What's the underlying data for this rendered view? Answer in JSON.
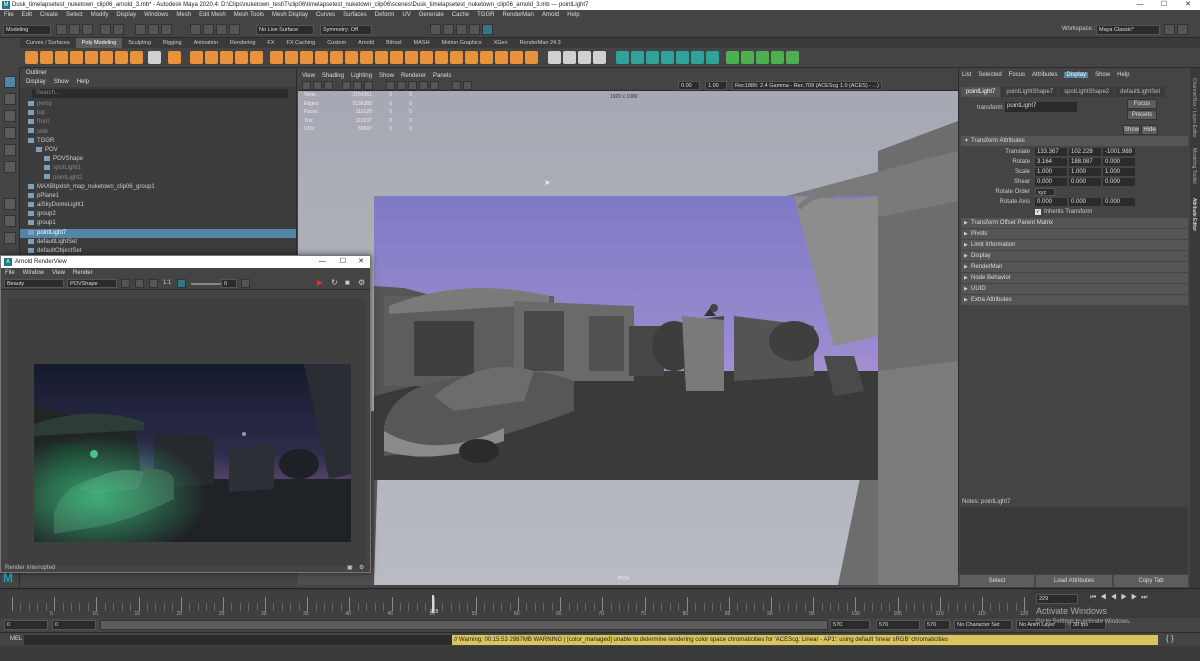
{
  "titlebar": {
    "title": "Dusk_timelapsetest_nuketown_clip06_arnold_3.mb* - Autodesk Maya 2020.4: D:\\Clips\\nuketown_test\\T\\clip06\\timelapsetest_nuketown_clip06\\scenes\\Dusk_timelapsetest_nuketown_clip06_arnold_3.mb  ---  pointLight7",
    "min": "—",
    "max": "☐",
    "close": "✕"
  },
  "menubar": [
    "File",
    "Edit",
    "Create",
    "Select",
    "Modify",
    "Display",
    "Windows",
    "Mesh",
    "Edit Mesh",
    "Mesh Tools",
    "Mesh Display",
    "Curves",
    "Surfaces",
    "Deform",
    "UV",
    "Generate",
    "Cache",
    "TGGR",
    "RenderMan",
    "Arnold",
    "Help"
  ],
  "statusline": {
    "mode": "Modeling",
    "live_surface": "No Live Surface",
    "symmetry": "Symmetry: Off",
    "workspace_label": "Workspace :",
    "workspace": "Maya Classic*"
  },
  "shelf_tabs": [
    "Curves / Surfaces",
    "Poly Modeling",
    "Sculpting",
    "Rigging",
    "Animation",
    "Rendering",
    "FX",
    "FX Caching",
    "Custom",
    "Arnold",
    "Bifrost",
    "MASH",
    "Motion Graphics",
    "XGen",
    "RenderMan 24.3"
  ],
  "shelf_active": "Poly Modeling",
  "outliner": {
    "title": "Outliner",
    "menu": [
      "Display",
      "Show",
      "Help"
    ],
    "search_placeholder": "Search...",
    "items": [
      {
        "label": "persp",
        "indent": 1,
        "state": "dim"
      },
      {
        "label": "top",
        "indent": 1,
        "state": "dim"
      },
      {
        "label": "front",
        "indent": 1,
        "state": "dim"
      },
      {
        "label": "side",
        "indent": 1,
        "state": "dim"
      },
      {
        "label": "TGGR",
        "indent": 1,
        "state": "normal"
      },
      {
        "label": "POV",
        "indent": 2,
        "state": "normal"
      },
      {
        "label": "POVShape",
        "indent": 3,
        "state": "normal"
      },
      {
        "label": "spotLight1",
        "indent": 3,
        "state": "dim"
      },
      {
        "label": "pointLight2",
        "indent": 3,
        "state": "dim"
      },
      {
        "label": "MAXBIpxlsh_map_nuketown_clip06_group1",
        "indent": 1,
        "state": "normal"
      },
      {
        "label": "pPlane1",
        "indent": 1,
        "state": "normal"
      },
      {
        "label": "aiSkyDomeLight1",
        "indent": 1,
        "state": "normal"
      },
      {
        "label": "group2",
        "indent": 1,
        "state": "normal"
      },
      {
        "label": "group1",
        "indent": 1,
        "state": "normal"
      },
      {
        "label": "pointLight7",
        "indent": 1,
        "state": "selected"
      },
      {
        "label": "defaultLightSet",
        "indent": 1,
        "state": "normal"
      },
      {
        "label": "defaultObjectSet",
        "indent": 1,
        "state": "normal"
      }
    ]
  },
  "viewport": {
    "menu": [
      "View",
      "Shading",
      "Lighting",
      "Show",
      "Renderer",
      "Panels"
    ],
    "exposure": "0.00",
    "gamma": "1.00",
    "colorspace": "Rec1886: 2.4 Gamma - Rec.709 (ACEScg 1.0 (ACES) - ...)",
    "resolution": "1920 x 1080",
    "camera_label": "POV",
    "hud": [
      {
        "label": "Verts:",
        "a": "2154361",
        "b": "0",
        "c": "0"
      },
      {
        "label": "Edges:",
        "a": "2156380",
        "b": "0",
        "c": "0"
      },
      {
        "label": "Faces:",
        "a": "110129",
        "b": "0",
        "c": "0"
      },
      {
        "label": "Tris:",
        "a": "110137",
        "b": "0",
        "c": "0"
      },
      {
        "label": "UVs:",
        "a": "56697",
        "b": "0",
        "c": "0"
      }
    ]
  },
  "attr": {
    "menu": [
      "List",
      "Selected",
      "Focus",
      "Attributes",
      "Display",
      "Show",
      "Help"
    ],
    "menu_highlight": "Display",
    "tabs": [
      "pointLight7",
      "pointLightShape7",
      "spotLightShape2",
      "defaultLightSet"
    ],
    "transform_label": "transform:",
    "transform_value": "pointLight7",
    "focus": "Focus",
    "presets": "Presets",
    "show": "Show",
    "hide": "Hide",
    "section_open": "Transform Attributes",
    "rows": [
      {
        "label": "Translate",
        "v": [
          "133.367",
          "102.228",
          "-1001.989"
        ]
      },
      {
        "label": "Rotate",
        "v": [
          "3.164",
          "188.087",
          "0.000"
        ]
      },
      {
        "label": "Scale",
        "v": [
          "1.000",
          "1.000",
          "1.000"
        ]
      },
      {
        "label": "Shear",
        "v": [
          "0.000",
          "0.000",
          "0.000"
        ]
      }
    ],
    "rotate_order_label": "Rotate Order",
    "rotate_order": "xyz",
    "rotate_axis_label": "Rotate Axis",
    "rotate_axis": [
      "0.000",
      "0.000",
      "0.000"
    ],
    "inherits": "Inherits Transform",
    "sections": [
      "Transform Offset Parent Matrix",
      "Pivots",
      "Limit Information",
      "Display",
      "RenderMan",
      "Node Behavior",
      "UUID",
      "Extra Attributes"
    ],
    "notes_label": "Notes: pointLight7",
    "btn_select": "Select",
    "btn_load": "Load Attributes",
    "btn_copy": "Copy Tab"
  },
  "sidetabs": [
    "Channel Box / Layer Editor",
    "Modeling Toolkit",
    "Attribute Editor"
  ],
  "arnold": {
    "title": "Arnold RenderView",
    "menu": [
      "File",
      "Window",
      "View",
      "Render"
    ],
    "aov": "Beauty",
    "camera": "POVShape",
    "ratio": "1:1",
    "exposure": "0",
    "status": "Render Interrupted"
  },
  "timeline": {
    "ticks": [
      "5",
      "10",
      "15",
      "20",
      "25",
      "30",
      "35",
      "40",
      "45",
      "50",
      "55",
      "60",
      "65",
      "70",
      "75",
      "80",
      "85",
      "90",
      "95",
      "100",
      "105",
      "110",
      "115",
      "120"
    ],
    "current_label": "229",
    "current_field": "229",
    "range_start": "0",
    "range_start2": "0",
    "range_end": "570",
    "range_end2": "570",
    "range_end3": "570",
    "character_set": "No Character Set",
    "anim_layer": "No Anim Layer",
    "fps": "30 fps"
  },
  "cmdline": {
    "label": "MEL",
    "message": "// Warning: 00:15:53 2987MB WARNING | [color_managed] unable to determine rendering color space chromaticities for 'ACEScg: Linear - AP1': using default 'linear sRGB' chromaticities"
  },
  "watermark": {
    "line1": "Activate Windows",
    "line2": "Go to Settings to activate Windows."
  },
  "colors": {
    "accent": "#5285a6",
    "shelf_orange": "#e8923a",
    "shelf_teal": "#2fa39a",
    "shelf_green": "#4caf50",
    "warning": "#d9c55c"
  }
}
